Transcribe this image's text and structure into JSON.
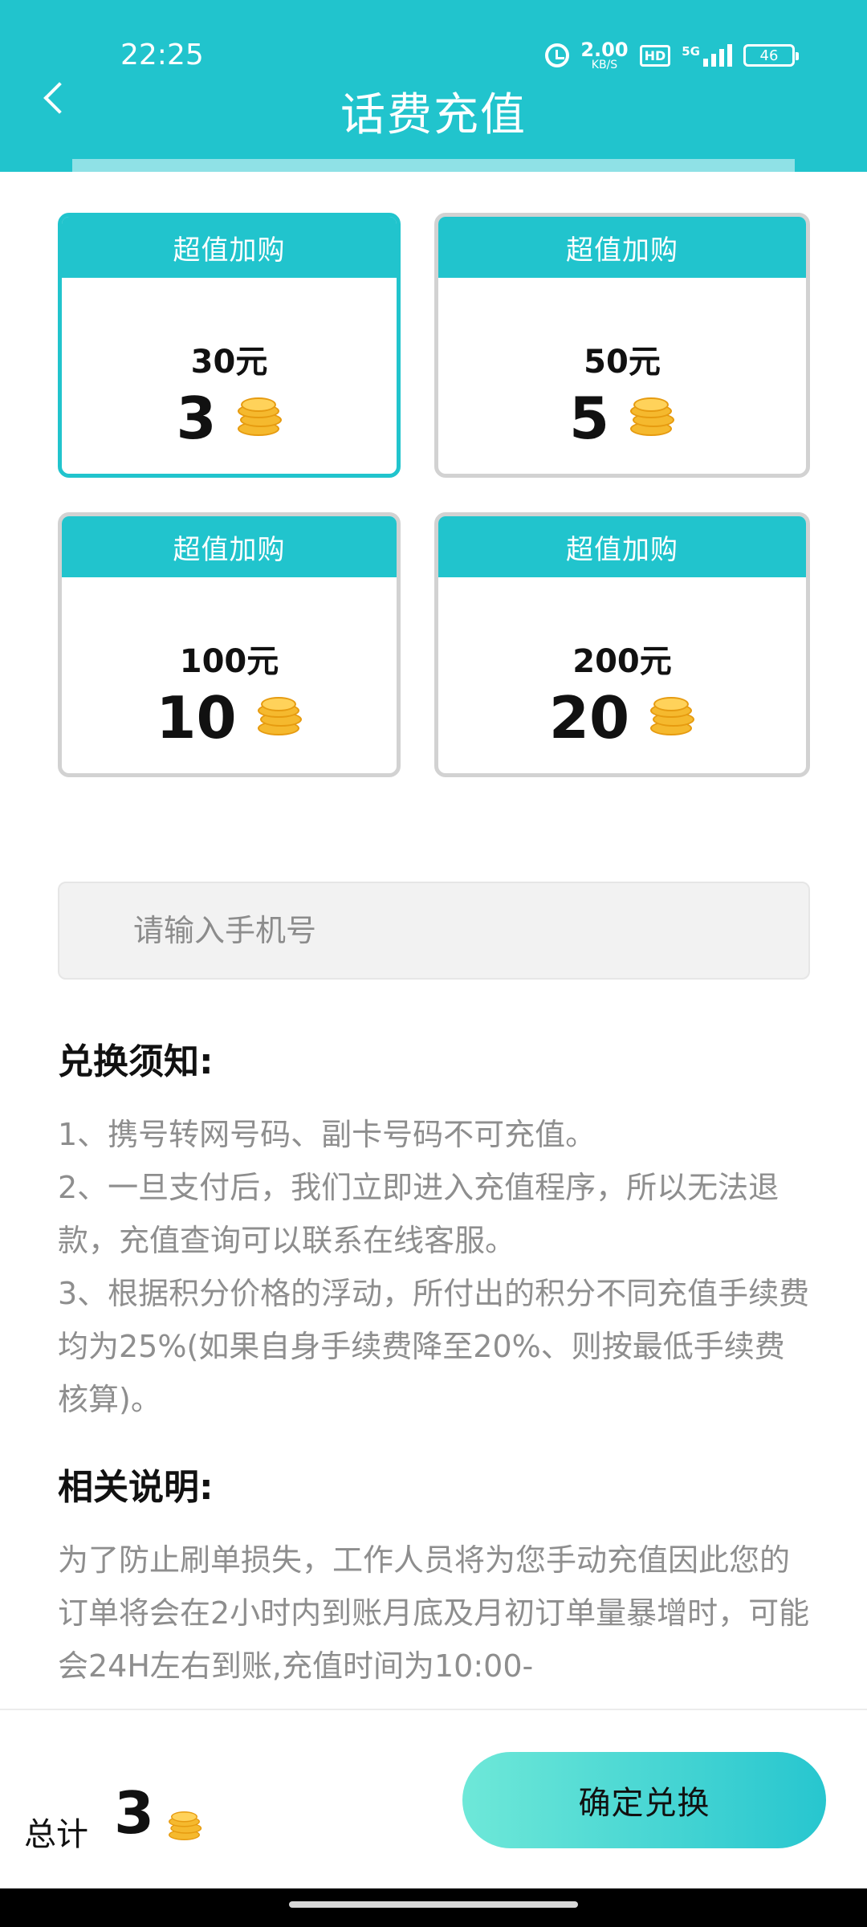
{
  "status_bar": {
    "time": "22:25",
    "speed_value": "2.00",
    "speed_unit": "KB/S",
    "hd": "HD",
    "network": "5G",
    "battery": "46"
  },
  "header": {
    "title": "话费充值"
  },
  "packages": [
    {
      "banner": "超值加购",
      "price": "30元",
      "points": "3",
      "selected": true
    },
    {
      "banner": "超值加购",
      "price": "50元",
      "points": "5",
      "selected": false
    },
    {
      "banner": "超值加购",
      "price": "100元",
      "points": "10",
      "selected": false
    },
    {
      "banner": "超值加购",
      "price": "200元",
      "points": "20",
      "selected": false
    }
  ],
  "phone": {
    "placeholder": "请输入手机号",
    "value": ""
  },
  "notice": {
    "title": "兑换须知:",
    "text": "1、携号转网号码、副卡号码不可充值。\n2、一旦支付后，我们立即进入充值程序，所以无法退款，充值查询可以联系在线客服。\n3、根据积分价格的浮动，所付出的积分不同充值手续费均为25%(如果自身手续费降至20%、则按最低手续费核算)。"
  },
  "explain": {
    "title": "相关说明:",
    "text": "为了防止刷单损失，工作人员将为您手动充值因此您的订单将会在2小时内到账月底及月初订单量暴增时，可能会24H左右到账,充值时间为10:00-"
  },
  "footer": {
    "total_label": "总计",
    "total_value": "3",
    "confirm_label": "确定兑换"
  },
  "colors": {
    "accent": "#21c4cd",
    "coin": "#f5b92e",
    "muted_text": "#8e8e8e"
  }
}
